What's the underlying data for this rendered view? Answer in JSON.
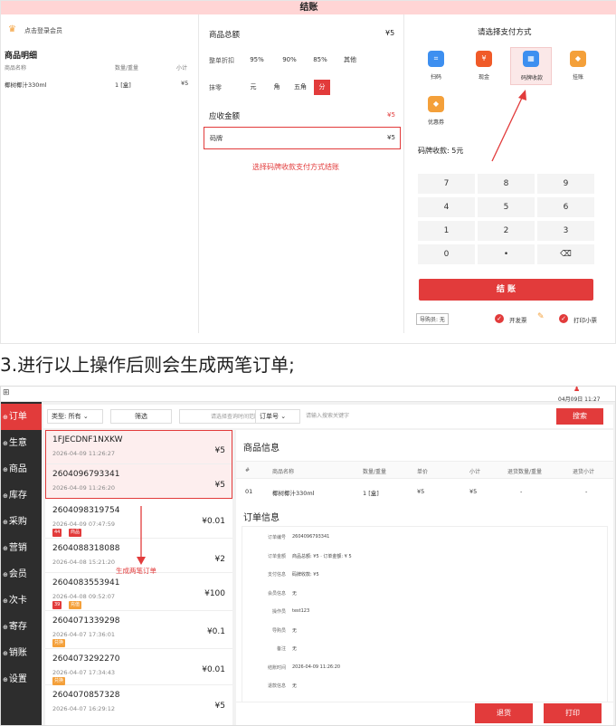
{
  "checkout": {
    "title": "结账",
    "login_member": "点击登录会员",
    "detail_title": "商品明细",
    "detail_headers": [
      "商品名称",
      "数量/重量",
      "小计"
    ],
    "item": {
      "name": "椰树椰汁330ml",
      "qty": "1 [盒]",
      "subtotal": "¥5"
    },
    "total_label": "商品总额",
    "total_value": "¥5",
    "discount_label": "整单折扣",
    "discount_options": [
      "95%",
      "90%",
      "85%",
      "其他"
    ],
    "rounding_label": "抹零",
    "rounding_options": [
      "元",
      "角",
      "五角",
      "分"
    ],
    "rounding_selected": "分",
    "receivable_label": "应收金额",
    "receivable_value": "¥5",
    "pay_row_label": "码牌",
    "pay_row_value": "¥5",
    "annotation": "选择码牌收款支付方式结账",
    "pay_method_title": "请选择支付方式",
    "pay_methods": [
      {
        "label": "扫码",
        "icon": "scan-icon",
        "color": "#3d8ff0"
      },
      {
        "label": "现金",
        "icon": "cash-icon",
        "color": "#f05a28"
      },
      {
        "label": "码牌收款",
        "icon": "qr-board-icon",
        "color": "#3d8ff0"
      },
      {
        "label": "挂账",
        "icon": "tag-icon",
        "color": "#f4a03a"
      },
      {
        "label": "优惠券",
        "icon": "coupon-icon",
        "color": "#f4a03a"
      }
    ],
    "pay_selected": "码牌收款",
    "pay_amount_text": "码牌收款: 5元",
    "keypad": [
      "7",
      "8",
      "9",
      "4",
      "5",
      "6",
      "1",
      "2",
      "3",
      "0",
      "•",
      "⌫"
    ],
    "checkout_button": "结 账",
    "cashier": "导购员: 无",
    "invoice": "开发票",
    "print_receipt": "打印小票"
  },
  "caption": "3.进行以上操作后则会生成两笔订单;",
  "orders_page": {
    "date_time": "04月09日 11:27",
    "sidebar": [
      "订单",
      "生意",
      "商品",
      "库存",
      "采购",
      "营销",
      "会员",
      "次卡",
      "寄存",
      "销账",
      "设置"
    ],
    "sidebar_active": "订单",
    "filter_type": "类型: 所有",
    "filter_button": "筛选",
    "time_placeholder": "请选择查询时间范围",
    "search_field": "订单号",
    "search_placeholder": "请输入搜索关键字",
    "search_button": "搜索",
    "orders": [
      {
        "no": "1FJECDNF1NXKW",
        "date": "2026-04-09 11:26:27",
        "amount": "¥5",
        "tags": []
      },
      {
        "no": "2604096793341",
        "date": "2026-04-09 11:26:20",
        "amount": "¥5",
        "tags": []
      },
      {
        "no": "2604098319754",
        "date": "2026-04-09 07:47:59",
        "amount": "¥0.01",
        "tags": [
          {
            "text": "44",
            "color": "#e23b3b"
          },
          {
            "text": "商品",
            "color": "#e23b3b"
          }
        ]
      },
      {
        "no": "2604088318088",
        "date": "2026-04-08 15:21:20",
        "amount": "¥2",
        "tags": []
      },
      {
        "no": "2604083553941",
        "date": "2026-04-08 09:52:07",
        "amount": "¥100",
        "tags": [
          {
            "text": "39",
            "color": "#e23b3b"
          },
          {
            "text": "充值",
            "color": "#f4a03a"
          }
        ]
      },
      {
        "no": "2604071339298",
        "date": "2026-04-07 17:36:01",
        "amount": "¥0.1",
        "tags": [
          {
            "text": "兑换",
            "color": "#f4a03a"
          }
        ]
      },
      {
        "no": "2604073292270",
        "date": "2026-04-07 17:34:43",
        "amount": "¥0.01",
        "tags": [
          {
            "text": "兑换",
            "color": "#f4a03a"
          }
        ]
      },
      {
        "no": "2604070857328",
        "date": "2026-04-07 16:29:12",
        "amount": "¥5",
        "tags": []
      }
    ],
    "annotation": "生成两笔订单",
    "goods_info_title": "商品信息",
    "goods_headers": [
      "#",
      "商品名称",
      "数量/重量",
      "单价",
      "小计",
      "退货数量/重量",
      "退货小计"
    ],
    "goods_row": [
      "01",
      "椰树椰汁330ml",
      "1 [盒]",
      "¥5",
      "¥5",
      "-",
      "-"
    ],
    "order_info_title": "订单信息",
    "order_info": [
      {
        "label": "订单编号",
        "value": "2604096793341"
      },
      {
        "label": "订单金额",
        "value": "商品总额: ¥5  ·  订单金额: ¥ 5"
      },
      {
        "label": "支付信息",
        "value": "码牌收款: ¥5"
      },
      {
        "label": "会员信息",
        "value": "无"
      },
      {
        "label": "操作员",
        "value": "test123"
      },
      {
        "label": "导购员",
        "value": "无"
      },
      {
        "label": "备注",
        "value": "无"
      },
      {
        "label": "结账时间",
        "value": "2026-04-09 11:26:20"
      },
      {
        "label": "退款信息",
        "value": "无"
      }
    ],
    "refund_button": "退货",
    "print_button": "打印"
  }
}
